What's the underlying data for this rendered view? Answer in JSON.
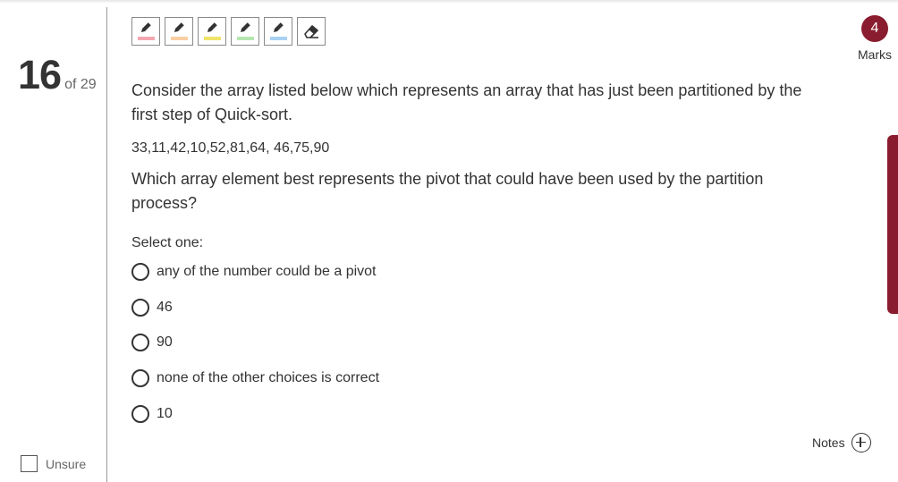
{
  "question": {
    "number": "16",
    "of_label": "of 29",
    "text": "Consider the array listed below which represents an array that has just been partitioned by the first step of Quick-sort.",
    "values": "33,11,42,10,52,81,64, 46,75,90",
    "prompt": "Which array element best represents the pivot that could have been used by the partition process?",
    "select_label": "Select one:",
    "options": [
      {
        "label": "any of the number could be a pivot"
      },
      {
        "label": "46"
      },
      {
        "label": "90"
      },
      {
        "label": "none of the other choices is correct"
      },
      {
        "label": "10"
      }
    ]
  },
  "marks": {
    "value": "4",
    "label": "Marks"
  },
  "unsure": {
    "label": "Unsure"
  },
  "notes": {
    "label": "Notes"
  },
  "highlighters": [
    {
      "icon": "pencil-icon",
      "color": "#f4a7b0"
    },
    {
      "icon": "pencil-icon",
      "color": "#f9cfa3"
    },
    {
      "icon": "pencil-icon",
      "color": "#f0e36a"
    },
    {
      "icon": "pencil-icon",
      "color": "#b6e6b0"
    },
    {
      "icon": "pencil-icon",
      "color": "#a9d1f2"
    },
    {
      "icon": "eraser-icon",
      "color": null
    }
  ],
  "colors": {
    "accent": "#8a1c2f"
  }
}
